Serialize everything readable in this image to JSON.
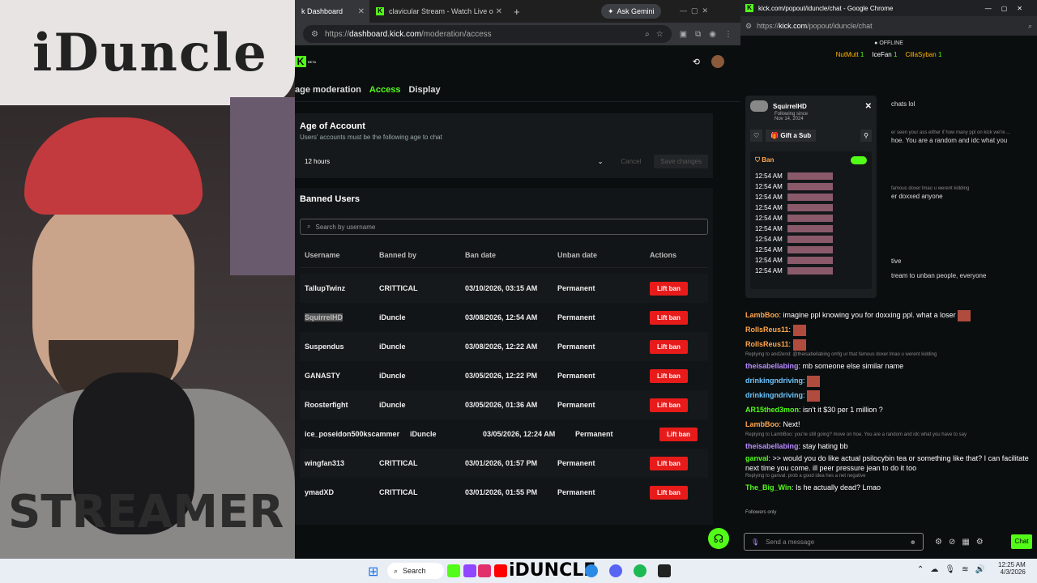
{
  "webcam": {
    "sign_text": "iDuncle",
    "hoodie_text": "STREAMER"
  },
  "left_window": {
    "tabs": [
      {
        "label": "k Dashboard"
      },
      {
        "label": "clavicular Stream - Watch Live o"
      }
    ],
    "ask_gemini": "Ask Gemini",
    "url_prefix": "https://",
    "url_host": "dashboard.kick.com",
    "url_path": "/moderation/access",
    "beta_label": "BETA",
    "subnav": [
      "age moderation",
      "Access",
      "Display"
    ],
    "age_card": {
      "title": "Age of Account",
      "desc": "Users' accounts must be the following age to chat",
      "value": "12 hours",
      "cancel": "Cancel",
      "save": "Save changes"
    },
    "banned": {
      "title": "Banned Users",
      "search_placeholder": "Search by username",
      "columns": [
        "Username",
        "Banned by",
        "Ban date",
        "Unban date",
        "Actions"
      ],
      "rows": [
        {
          "user": "TallupTwinz",
          "by": "CRITTICAL",
          "date": "03/10/2026, 03:15 AM",
          "unban": "Permanent"
        },
        {
          "user": "SquirrelHD",
          "by": "iDuncle",
          "date": "03/08/2026, 12:54 AM",
          "unban": "Permanent"
        },
        {
          "user": "Suspendus",
          "by": "iDuncle",
          "date": "03/08/2026, 12:22 AM",
          "unban": "Permanent"
        },
        {
          "user": "GANASTY",
          "by": "iDuncle",
          "date": "03/05/2026, 12:22 PM",
          "unban": "Permanent"
        },
        {
          "user": "Roosterfight",
          "by": "iDuncle",
          "date": "03/05/2026, 01:36 AM",
          "unban": "Permanent"
        },
        {
          "user": "ice_poseidon500kscammer",
          "by": "iDuncle",
          "date": "03/05/2026, 12:24 AM",
          "unban": "Permanent"
        },
        {
          "user": "wingfan313",
          "by": "CRITTICAL",
          "date": "03/01/2026, 01:57 PM",
          "unban": "Permanent"
        },
        {
          "user": "ymadXD",
          "by": "CRITTICAL",
          "date": "03/01/2026, 01:55 PM",
          "unban": "Permanent"
        }
      ],
      "action_label": "Lift ban"
    }
  },
  "right_window": {
    "title": "kick.com/popout/iduncle/chat - Google Chrome",
    "url_prefix": "https://",
    "url_host": "kick.com",
    "url_path": "/popout/iduncle/chat",
    "status": "OFFLINE",
    "gifters": [
      {
        "name": "NutMutt",
        "count": "1"
      },
      {
        "name": "IceFan",
        "count": "1"
      },
      {
        "name": "CillaSyban",
        "count": "1"
      }
    ],
    "popup": {
      "user": "SquirrelHD",
      "following_since": "Following since",
      "date": "Nov 14, 2024",
      "gift": "Gift a Sub",
      "ban": "Ban",
      "times": [
        "12:54 AM",
        "12:54 AM",
        "12:54 AM",
        "12:54 AM",
        "12:54 AM",
        "12:54 AM",
        "12:54 AM",
        "12:54 AM",
        "12:54 AM",
        "12:54 AM"
      ]
    },
    "behind_fragments": [
      "chats lol",
      "er seen your ass either if how many ppl on kick we're ...",
      "hoe. You are a random and idc what you",
      "famous doxer lmao u werent kidding",
      "er doxxed anyone",
      "tive",
      "tream to unban people, everyone"
    ],
    "messages": [
      {
        "name": "LambBoo",
        "text": "imagine ppl knowing you for doxxing ppl. what a loser",
        "color": "o"
      },
      {
        "name": "RollsReus11",
        "text": "",
        "color": "o"
      },
      {
        "name": "RollsReus11",
        "text": "",
        "color": "o"
      },
      {
        "reply": "Replying to and2end: @theisabellabing omfg ur that famous doxer lmao u werent kidding"
      },
      {
        "name": "theisabellabing",
        "text": "mb someone else similar name",
        "color": "p"
      },
      {
        "name": "drinkingndriving",
        "text": "",
        "color": "b"
      },
      {
        "name": "drinkingndriving",
        "text": "",
        "color": "b"
      },
      {
        "name": "AR15thed3mon",
        "text": "isn't it $30 per 1 million ?",
        "color": "g"
      },
      {
        "name": "LambBoo",
        "text": "Next!",
        "color": "o"
      },
      {
        "reply": "Replying to LambBoo: you're still going? move on hoe. You are a random and idc what you have to say"
      },
      {
        "name": "theisabellabing",
        "text": "stay hating bb",
        "color": "p"
      },
      {
        "name": "ganval",
        "text": ">> would you do like actual psilocybin tea or something like that? I can facilitate next time you come. ill peer pressure jean to do it too",
        "color": "g"
      },
      {
        "reply": "Replying to ganval: prob a good idea hes a net negative"
      },
      {
        "name": "The_Big_Win",
        "text": "Is he actually dead? Lmao",
        "color": "g"
      }
    ],
    "followers_only": "Followers only",
    "send_placeholder": "Send a message",
    "chat_button": "Chat"
  },
  "taskbar": {
    "search": "Search",
    "time": "12:25 AM",
    "date": "4/3/2026",
    "iduncle": "iDUNCLE"
  }
}
